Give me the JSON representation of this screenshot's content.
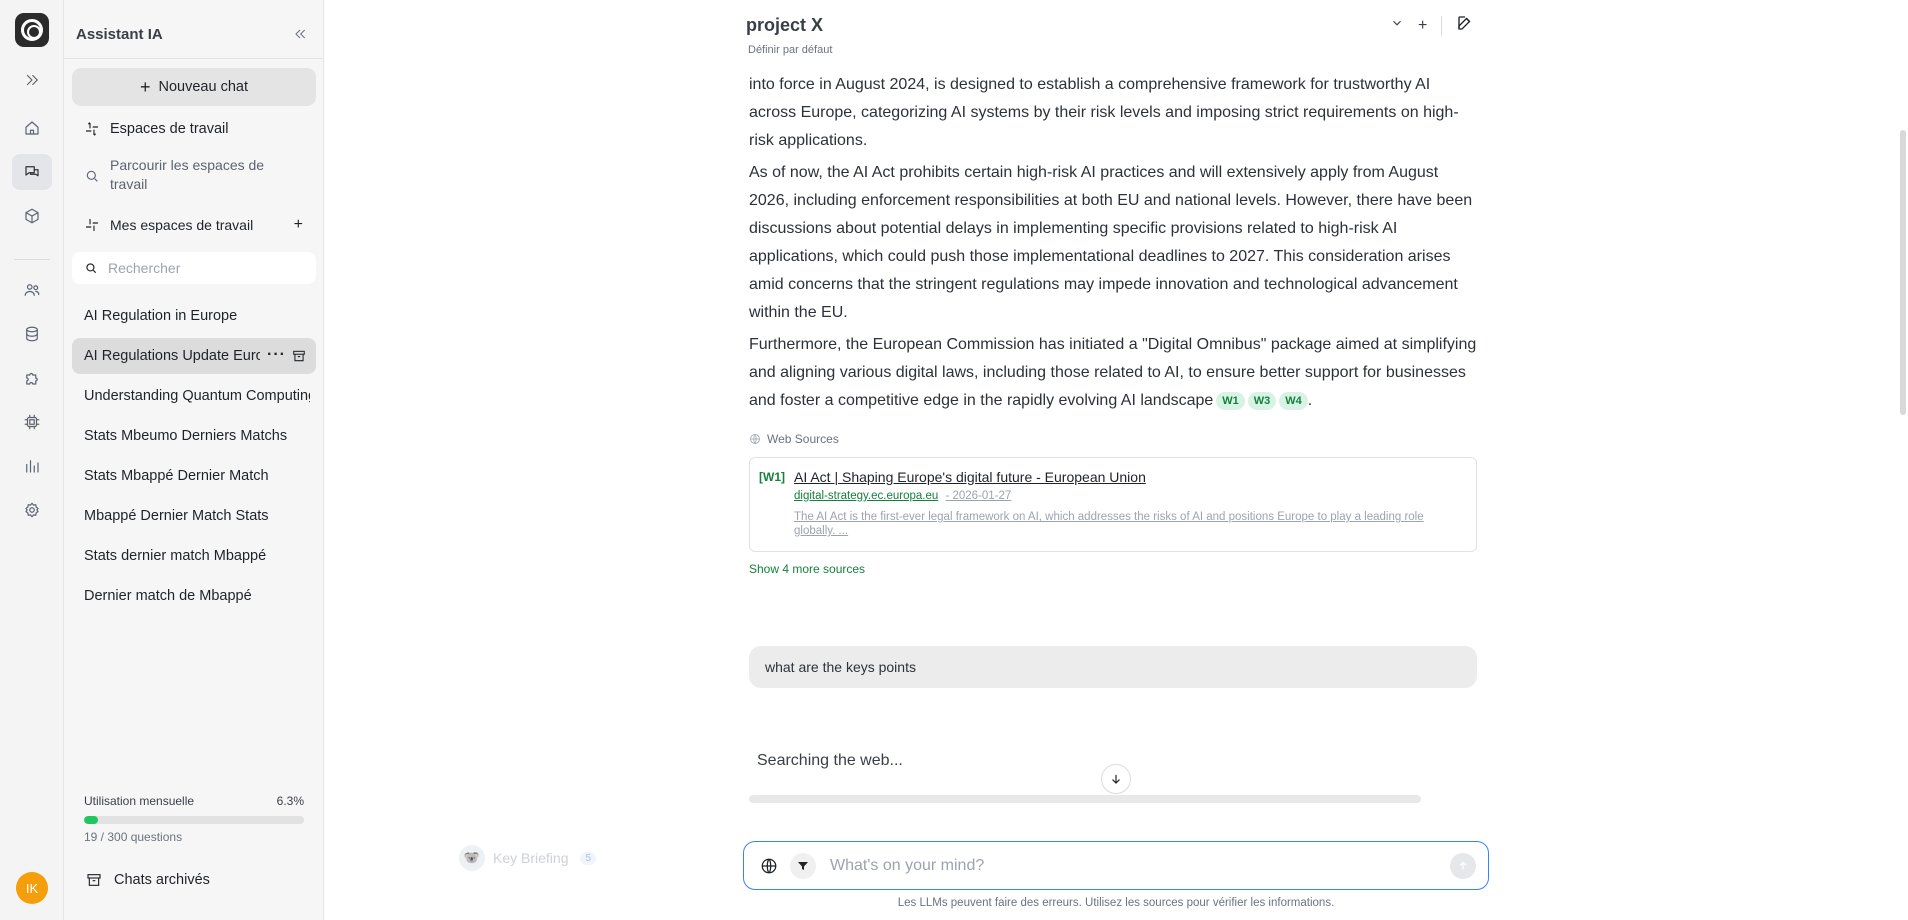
{
  "sidebar": {
    "title": "Assistant IA",
    "new_chat": "Nouveau chat",
    "workspaces": "Espaces de travail",
    "browse": "Parcourir les espaces de travail",
    "my_workspaces": "Mes espaces de travail",
    "search_placeholder": "Rechercher",
    "chats": [
      "AI Regulation in Europe",
      "AI Regulations Update Europe",
      "Understanding Quantum Computing",
      "Stats Mbeumo Derniers Matchs",
      "Stats Mbappé Dernier Match",
      "Mbappé Dernier Match Stats",
      "Stats dernier match Mbappé",
      "Dernier match de Mbappé"
    ],
    "active_chat_index": 1,
    "usage": {
      "label": "Utilisation mensuelle",
      "percent_text": "6.3%",
      "percent": 6.3,
      "questions": "19 / 300 questions"
    },
    "archived": "Chats archivés"
  },
  "rail": {
    "avatar_initials": "IK",
    "icons": [
      "expand-icon",
      "home-icon",
      "chat-icon",
      "cube-icon",
      "users-icon",
      "database-icon",
      "puzzle-icon",
      "chip-icon",
      "chart-icon",
      "settings-icon"
    ],
    "accent_color": "#22c55e"
  },
  "header": {
    "title": "project X",
    "subtitle": "Définir par défaut"
  },
  "message": {
    "p1": "into force in August 2024, is designed to establish a comprehensive framework for trustworthy AI across Europe, categorizing AI systems by their risk levels and imposing strict requirements on high-risk applications.",
    "p2": "As of now, the AI Act prohibits certain high-risk AI practices and will extensively apply from August 2026, including enforcement responsibilities at both EU and national levels. However, there have been discussions about potential delays in implementing specific provisions related to high-risk AI applications, which could push those implementational deadlines to 2027. This consideration arises amid concerns that the stringent regulations may impede innovation and technological advancement within the EU.",
    "p3": "Furthermore, the European Commission has initiated a \"Digital Omnibus\" package aimed at simplifying and aligning various digital laws, including those related to AI, to ensure better support for businesses and foster a competitive edge in the rapidly evolving AI landscape",
    "citations": [
      "W1",
      "W3",
      "W4"
    ],
    "p3_end": "."
  },
  "sources": {
    "label": "Web Sources",
    "card": {
      "tag": "[W1]",
      "title": "AI Act | Shaping Europe's digital future - European Union",
      "domain": "digital-strategy.ec.europa.eu",
      "date": "- 2026-01-27",
      "snippet": "The AI Act is the first-ever legal framework on AI, which addresses the risks of AI and positions Europe to play a leading role globally. ..."
    },
    "show_more": "Show 4 more sources"
  },
  "user_message": "what are the keys points",
  "status": "Searching the web...",
  "briefing": {
    "label": "Key Briefing",
    "count": "5"
  },
  "composer": {
    "placeholder": "What's on your mind?"
  },
  "disclaimer": "Les LLMs peuvent faire des erreurs. Utilisez les sources pour vérifier les informations."
}
